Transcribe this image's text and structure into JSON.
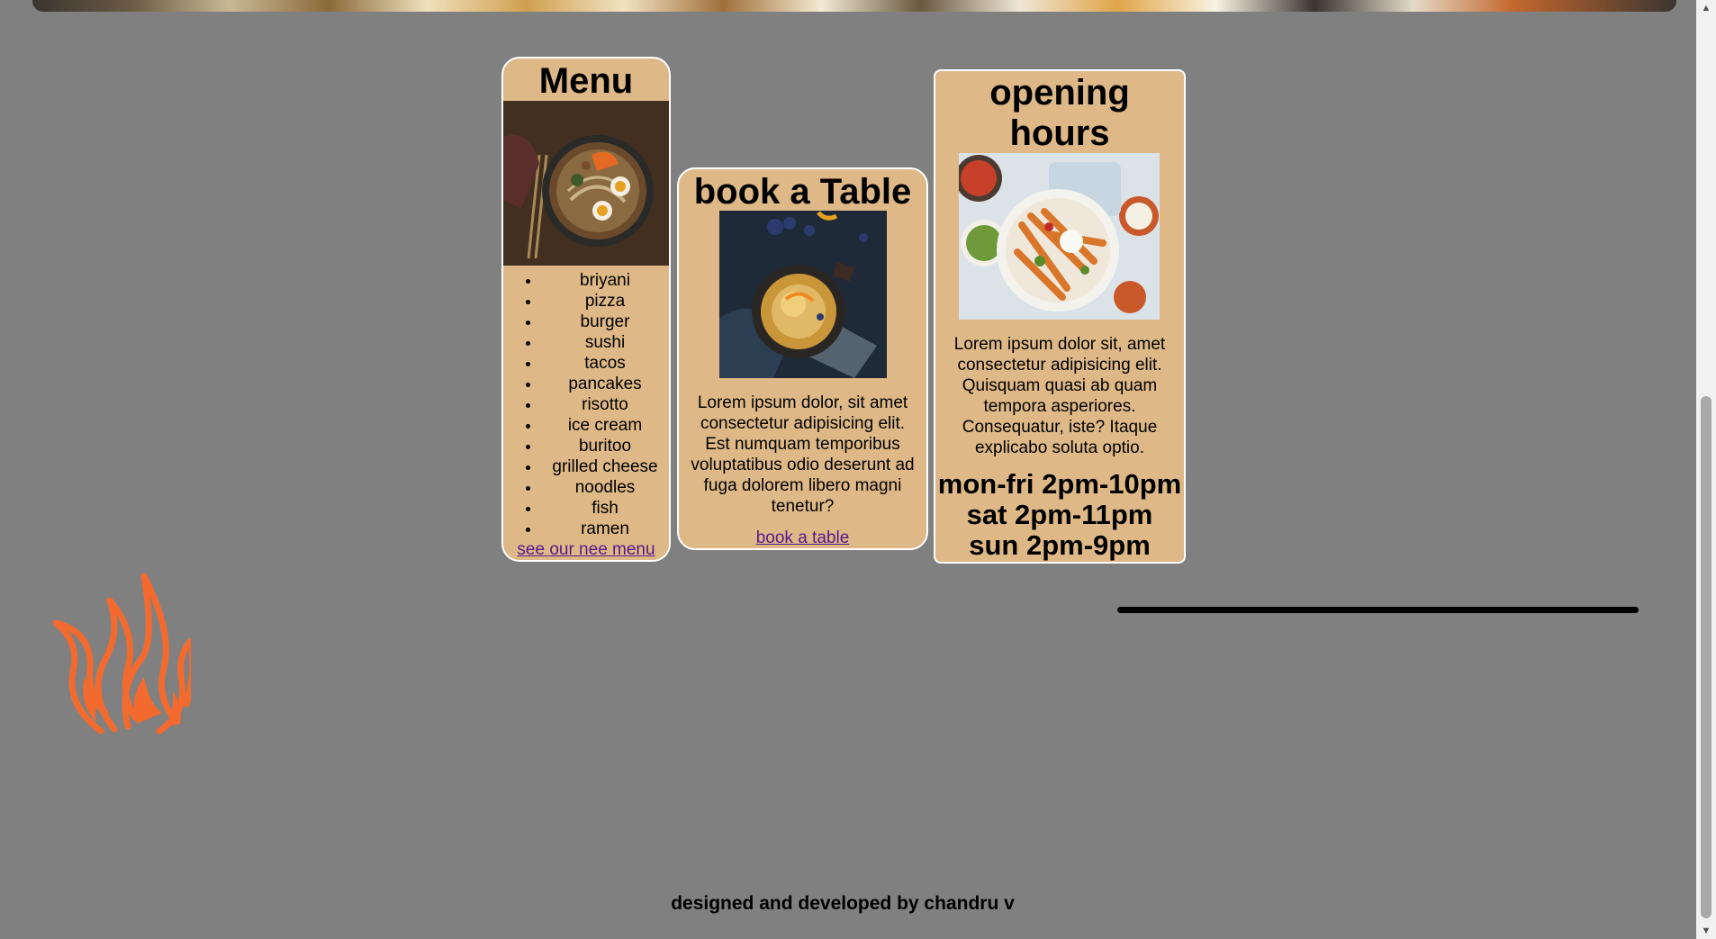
{
  "menu": {
    "title": "Menu",
    "items": [
      "briyani",
      "pizza",
      "burger",
      "sushi",
      "tacos",
      "pancakes",
      "risotto",
      "ice cream",
      "buritoo",
      "grilled cheese",
      "noodles",
      "fish",
      "ramen"
    ],
    "link": "see our nee menu"
  },
  "table": {
    "title": "book a Table",
    "text": "Lorem ipsum dolor, sit amet consectetur adipisicing elit. Est numquam temporibus voluptatibus odio deserunt ad fuga dolorem libero magni tenetur?",
    "link": "book a table"
  },
  "hours": {
    "title": "opening hours",
    "text": "Lorem ipsum dolor sit, amet consectetur adipisicing elit. Quisquam quasi ab quam tempora asperiores. Consequatur, iste? Itaque explicabo soluta optio.",
    "times": [
      "mon-fri 2pm-10pm",
      "sat 2pm-11pm",
      "sun 2pm-9pm"
    ]
  },
  "footer": {
    "text": "designed and developed by chandru v"
  },
  "colors": {
    "background": "#808080",
    "card": "#deb887",
    "flame": "#f26a2e",
    "link": "#551a8b"
  },
  "icons": {
    "logo": "flame-icon"
  }
}
